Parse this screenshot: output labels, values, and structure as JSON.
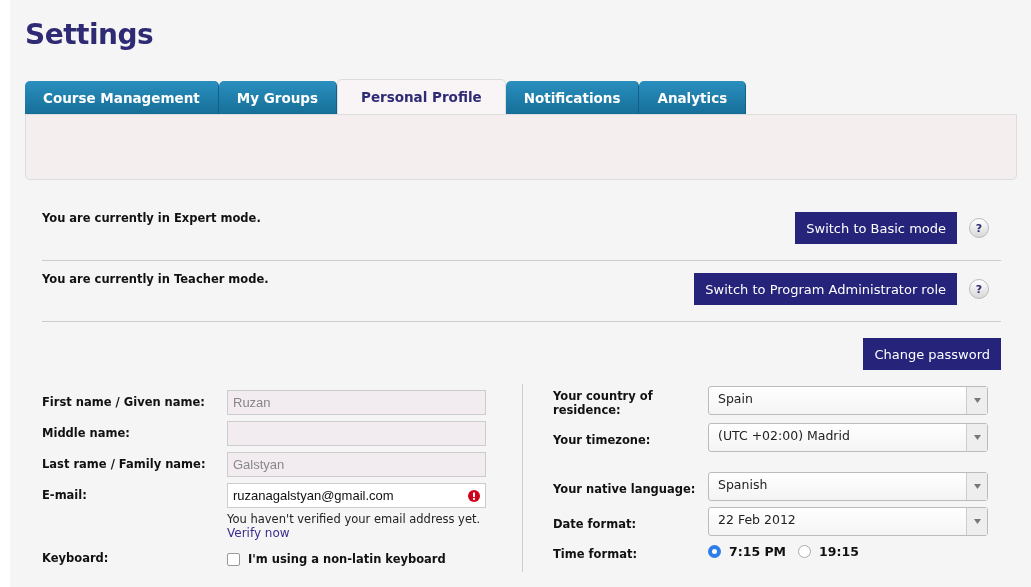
{
  "title": "Settings",
  "tabs": [
    {
      "label": "Course Management",
      "selected": false
    },
    {
      "label": "My Groups",
      "selected": false
    },
    {
      "label": "Personal Profile",
      "selected": true
    },
    {
      "label": "Notifications",
      "selected": false
    },
    {
      "label": "Analytics",
      "selected": false
    }
  ],
  "mode_rows": [
    {
      "text": "You are currently in Expert mode.",
      "button": "Switch to Basic mode",
      "help": "?"
    },
    {
      "text": "You are currently in Teacher mode.",
      "button": "Switch to Program Administrator role",
      "help": "?"
    }
  ],
  "change_password": "Change password",
  "left_fields": [
    {
      "label": "First name / Given name:",
      "value": "Ruzan",
      "disabled": true,
      "error": false
    },
    {
      "label": "Middle name:",
      "disabled": true,
      "error": false
    },
    {
      "label": "Last rame / Family name:",
      "value": "Galstyan",
      "disabled": true,
      "error": false
    },
    {
      "label": "E-mail:",
      "value": "ruzanagalstyan@gmail.com",
      "disabled": false,
      "error": true,
      "note": "You haven't verified your email address yet.",
      "link": "Verify now"
    }
  ],
  "keyboard": {
    "label": "Keyboard:",
    "option": "I'm using a non-latin keyboard",
    "checked": false
  },
  "right_groups": [
    [
      {
        "label": "Your country of residence:",
        "value": "Spain"
      },
      {
        "label": "Your timezone:",
        "value": "(UTC +02:00) Madrid"
      }
    ],
    [
      {
        "label": "Your native language:",
        "value": "Spanish"
      },
      {
        "label": "Date format:",
        "value": "22 Feb 2012"
      }
    ]
  ],
  "time_format": {
    "label": "Time format:",
    "options": [
      {
        "label": "7:15 PM",
        "selected": true
      },
      {
        "label": "19:15",
        "selected": false
      }
    ]
  }
}
